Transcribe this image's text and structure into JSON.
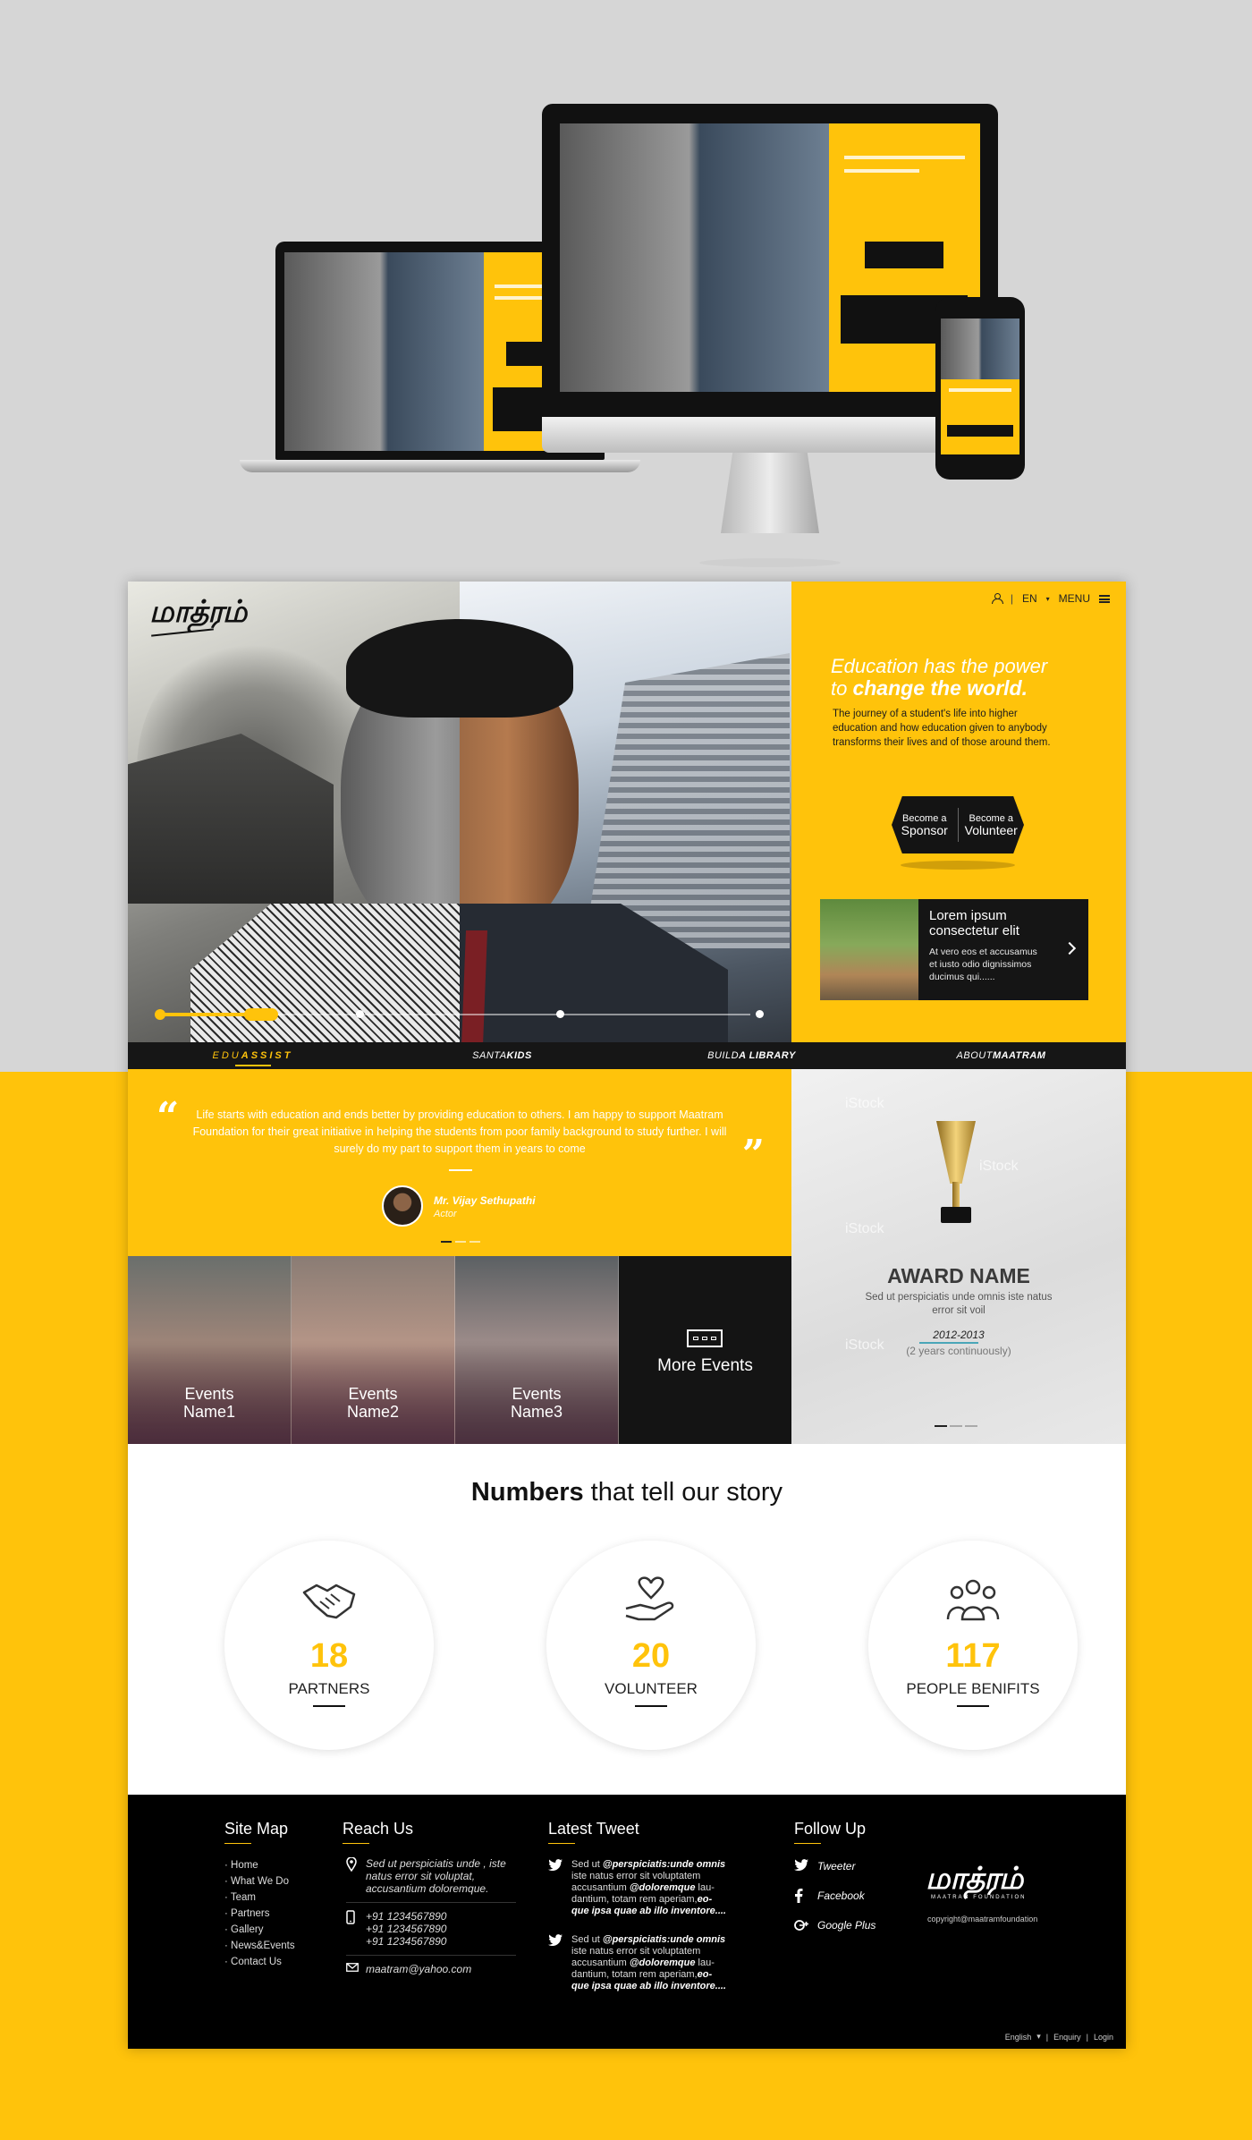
{
  "logo": {
    "text": "மாத்ரம்"
  },
  "topnav": {
    "lang": "EN",
    "menu": "MENU"
  },
  "hero": {
    "title_line1": "Education has the power",
    "title_line2_prefix": "to ",
    "title_line2_bold": "change the world.",
    "text": "The journey of a student's life into higher education and how education given to anybody transforms their lives and of those around them.",
    "sponsor_small": "Become a",
    "sponsor_big": "Sponsor",
    "volunteer_small": "Become a",
    "volunteer_big": "Volunteer",
    "news_title": "Lorem ipsum consectetur elit",
    "news_text": "At vero eos et accusamus et iusto odio dignissimos ducimus qui......"
  },
  "tabs": [
    {
      "pre": "EDU",
      "bold": "ASSIST"
    },
    {
      "pre": "SANTA",
      "bold": "KIDS"
    },
    {
      "pre": "BUILD ",
      "bold": "A LIBRARY"
    },
    {
      "pre": "ABOUT ",
      "bold": "MAATRAM"
    }
  ],
  "testimonial": {
    "text": "Life starts with education and ends better by providing education to others. I am happy to support Maatram Foundation for their great initiative in helping the students from poor family background to study further. I will surely do my part to support them in years to come",
    "author": "Mr. Vijay Sethupathi",
    "role": "Actor"
  },
  "events": [
    {
      "line1": "Events",
      "line2": "Name1"
    },
    {
      "line1": "Events",
      "line2": "Name2"
    },
    {
      "line1": "Events",
      "line2": "Name3"
    }
  ],
  "more_events": "More Events",
  "award": {
    "watermark": "iStock",
    "name": "AWARD NAME",
    "text": "Sed ut perspiciatis unde omnis iste natus error sit voil",
    "years": "2012-2013",
    "continuity": "(2 years continuously)"
  },
  "numbers": {
    "title_bold": "Numbers",
    "title_rest": " that tell our story",
    "stats": [
      {
        "value": "18",
        "label": "PARTNERS",
        "icon": "handshake-icon"
      },
      {
        "value": "20",
        "label": "VOLUNTEER",
        "icon": "heart-hand-icon"
      },
      {
        "value": "117",
        "label": "PEOPLE BENIFITS",
        "icon": "people-group-icon"
      }
    ]
  },
  "footer": {
    "sitemap_title": "Site Map",
    "sitemap": [
      "· Home",
      "· What We Do",
      "· Team",
      "· Partners",
      "· Gallery",
      "· News&Events",
      "· Contact Us"
    ],
    "reach_title": "Reach Us",
    "address": "Sed ut perspiciatis unde , iste natus error sit voluptat, accusantium doloremque.",
    "phones": [
      "+91 1234567890",
      "+91 1234567890",
      "+91 1234567890"
    ],
    "email": "maatram@yahoo.com",
    "tweet_title": "Latest Tweet",
    "tweets": [
      {
        "pre": "Sed ut ",
        "handle1": "@perspiciatis:unde omnis",
        "mid": " iste natus error sit voluptatem accusantium ",
        "handle2": "@doloremque",
        "post": " lau-dantium, totam rem aperiam,",
        "tail": "eo-que ipsa quae ab illo inventore...."
      },
      {
        "pre": "Sed ut ",
        "handle1": "@perspiciatis:unde omnis",
        "mid": " iste natus error sit voluptatem accusantium ",
        "handle2": "@doloremque",
        "post": " lau-dantium, totam rem aperiam,",
        "tail": "eo-que ipsa quae ab illo inventore...."
      }
    ],
    "follow_title": "Follow Up",
    "follow": [
      "Tweeter",
      "Facebook",
      "Google Plus"
    ],
    "logo_sub": "MAATRAM FOUNDATION",
    "copyright": "copyright@maatramfoundation",
    "bottom_lang": "English",
    "bottom_enquiry": "Enquiry",
    "bottom_login": "Login"
  },
  "colors": {
    "accent": "#ffc30b",
    "dark": "#141414"
  }
}
